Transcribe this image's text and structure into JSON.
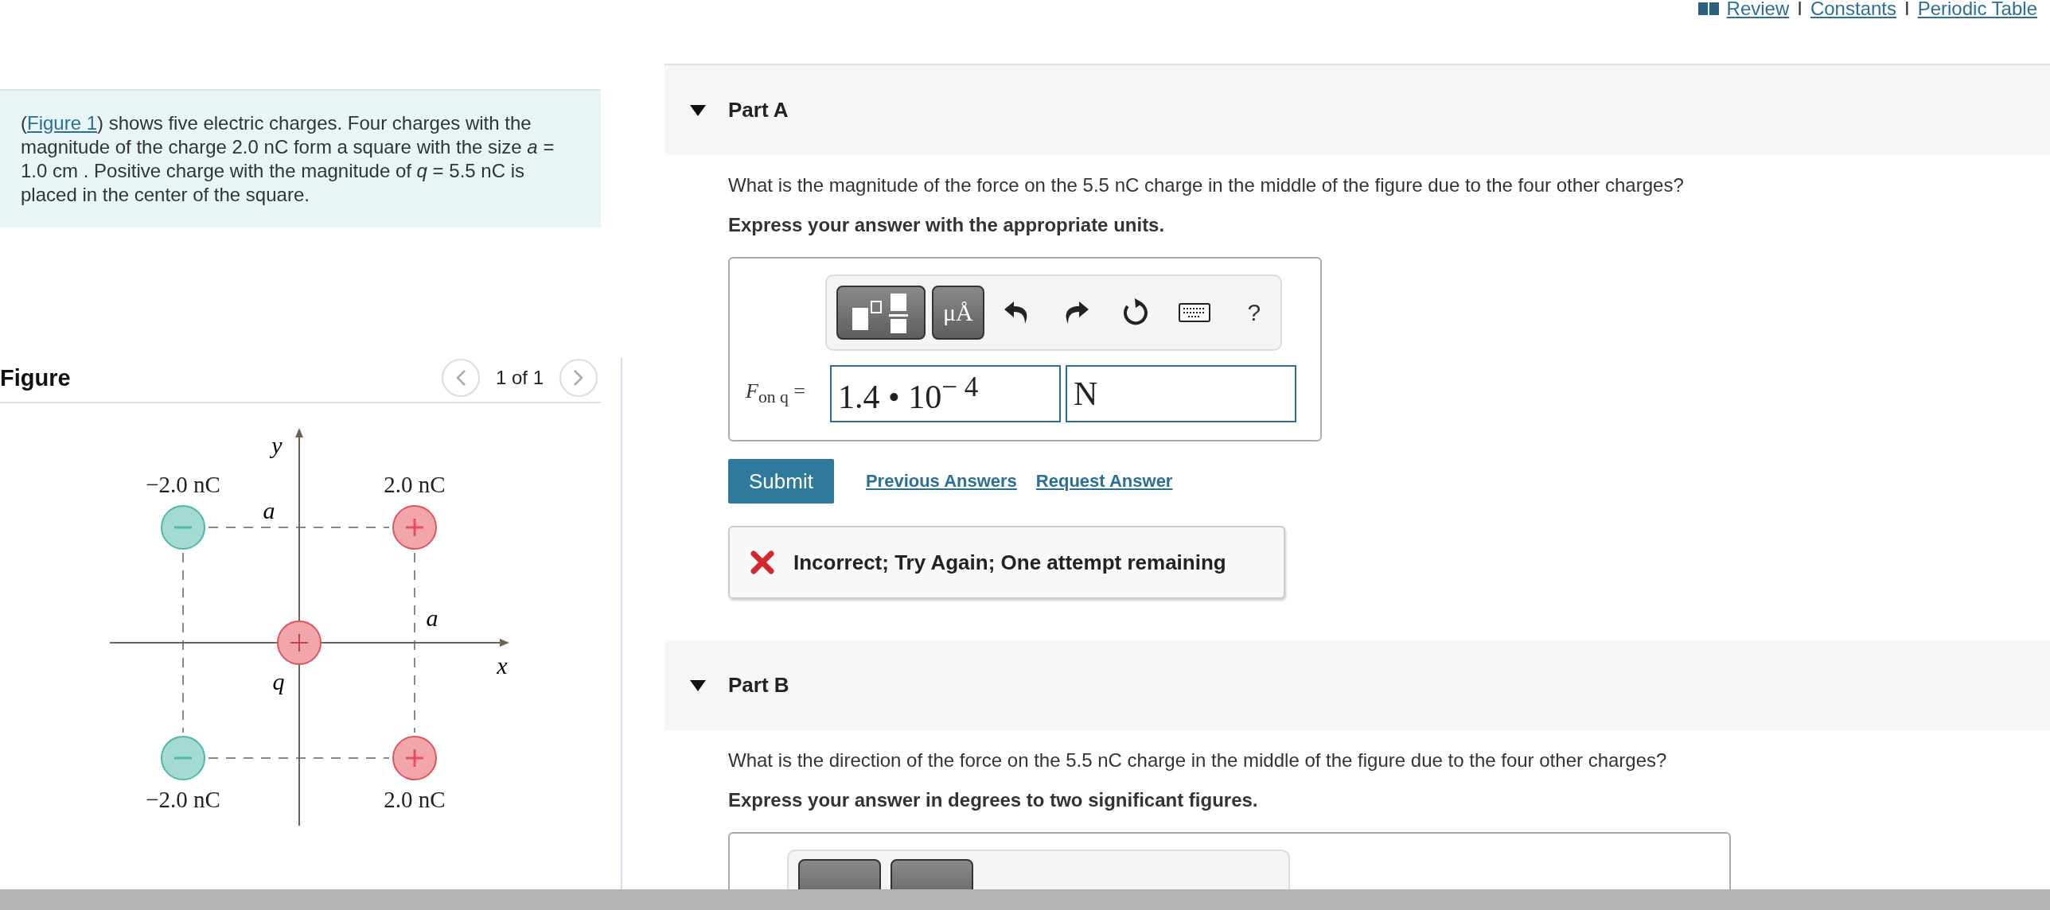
{
  "top_links": [
    {
      "label": "Review"
    },
    {
      "label": "Constants"
    },
    {
      "label": "Periodic Table"
    }
  ],
  "link_separators": [
    "I",
    "I"
  ],
  "intro": {
    "open": "(",
    "link": "Figure 1",
    "text": ") shows five electric charges. Four charges with the magnitude of the charge 2.0 nC form a square with the size *a* = 1.0 cm . Positive charge with the magnitude of *q* = 5.5 nC is placed in the center of the square."
  },
  "figure": {
    "title": "Figure",
    "pager": "1 of 1",
    "charges": [
      {
        "label": "−2.0 nC",
        "kind": "negative"
      },
      {
        "label": "2.0 nC",
        "kind": "positive"
      },
      {
        "label": "−2.0 nC",
        "kind": "negative"
      },
      {
        "label": "2.0 nC",
        "kind": "positive"
      }
    ],
    "center_label": "q",
    "x_label": "x",
    "y_label": "y",
    "side_labels": [
      "a",
      "a"
    ]
  },
  "parts": [
    {
      "title": "Part A",
      "question": "What is the magnitude of the force on the 5.5 nC charge in the middle of the figure due to the four other charges?",
      "instruction": "Express your answer with the appropriate units.",
      "answer": {
        "units_button": "μÅ",
        "help": "?",
        "label": "*F*$_{on q}$ =",
        "value": "1.4 • 10$^{− 4}$",
        "unit": "N"
      },
      "submit": "Submit",
      "links": [
        "Previous Answers",
        "Request Answer"
      ],
      "feedback": "Incorrect; Try Again; One attempt remaining"
    },
    {
      "title": "Part B",
      "question": "What is the direction of the force on the 5.5 nC charge in the middle of the figure due to the four other charges?",
      "instruction": "Express your answer in degrees to two significant figures."
    }
  ]
}
